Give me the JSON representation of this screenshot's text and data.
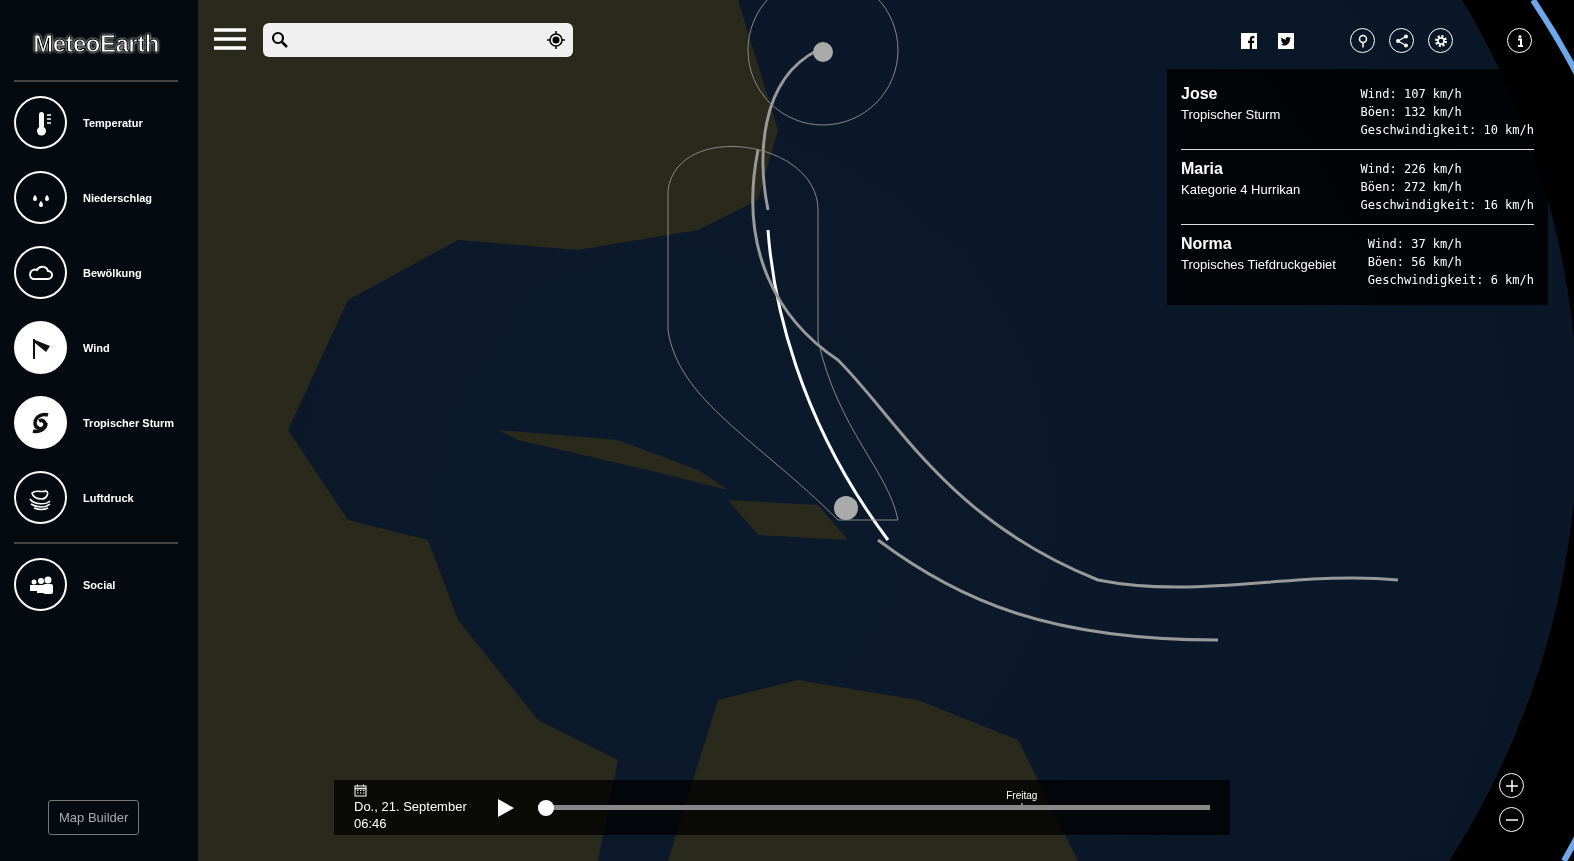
{
  "logo": "MeteoEarth",
  "sidebar": {
    "items": [
      {
        "label": "Temperatur",
        "kind": "thermometer",
        "selected": false
      },
      {
        "label": "Niederschlag",
        "kind": "drops",
        "selected": false
      },
      {
        "label": "Bewölkung",
        "kind": "cloud",
        "selected": false
      },
      {
        "label": "Wind",
        "kind": "windsock",
        "selected": true
      },
      {
        "label": "Tropischer Sturm",
        "kind": "cyclone",
        "selected": true
      },
      {
        "label": "Luftdruck",
        "kind": "isobars",
        "selected": false
      }
    ],
    "social": {
      "label": "Social",
      "kind": "people",
      "selected": false
    },
    "map_builder": "Map Builder"
  },
  "storms": [
    {
      "name": "Jose",
      "type": "Tropischer Sturm",
      "stats": [
        "Wind: 107 km/h",
        "Böen: 132 km/h",
        "Geschwindigkeit: 10 km/h"
      ]
    },
    {
      "name": "Maria",
      "type": "Kategorie 4 Hurrikan",
      "stats": [
        "Wind: 226 km/h",
        "Böen: 272 km/h",
        "Geschwindigkeit: 16 km/h"
      ]
    },
    {
      "name": "Norma",
      "type": "Tropisches Tiefdruckgebiet",
      "stats": [
        "Wind: 37 km/h",
        "Böen: 56 km/h",
        "Geschwindigkeit: 6 km/h"
      ]
    }
  ],
  "timeline": {
    "date": "Do., 21. September",
    "time": "06:46",
    "level": 0,
    "tick_label": "Freitag"
  }
}
